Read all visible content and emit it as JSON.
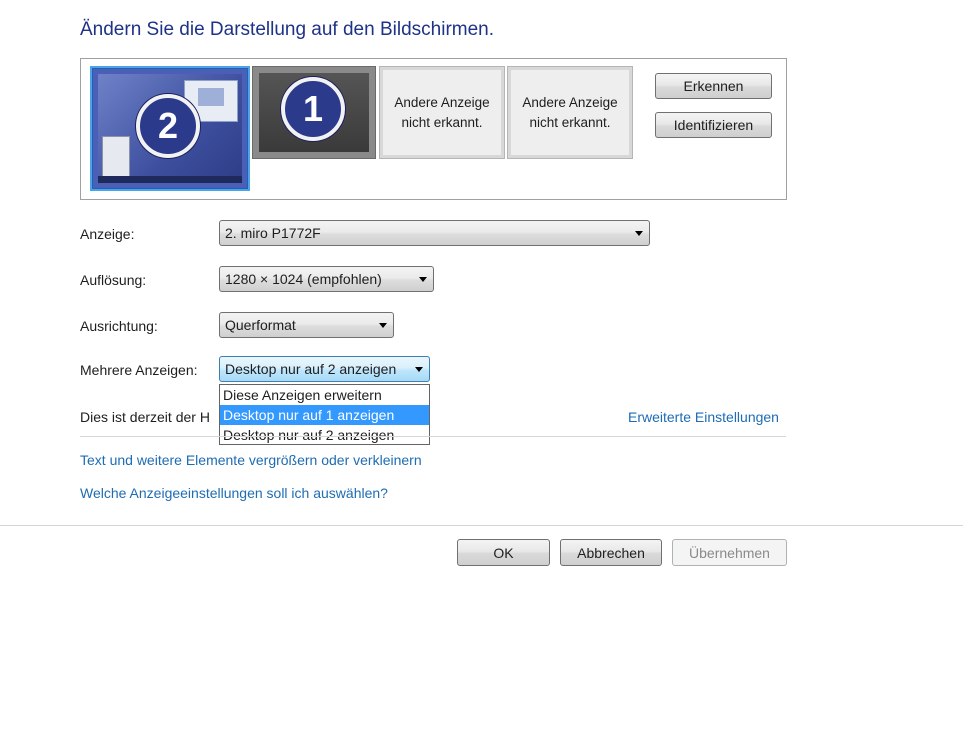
{
  "title": "Ändern Sie die Darstellung auf den Bildschirmen.",
  "monitors": {
    "selected_number": "2",
    "second_number": "1",
    "not_detected_1": "Andere Anzeige nicht erkannt.",
    "not_detected_2": "Andere Anzeige nicht erkannt."
  },
  "buttons": {
    "detect": "Erkennen",
    "identify": "Identifizieren",
    "ok": "OK",
    "cancel": "Abbrechen",
    "apply": "Übernehmen"
  },
  "fields": {
    "display_label": "Anzeige:",
    "display_value": "2. miro P1772F",
    "resolution_label": "Auflösung:",
    "resolution_value": "1280 × 1024 (empfohlen)",
    "orientation_label": "Ausrichtung:",
    "orientation_value": "Querformat",
    "multiple_label": "Mehrere Anzeigen:",
    "multiple_value": "Desktop nur auf 2 anzeigen"
  },
  "dropdown_options": [
    "Diese Anzeigen erweitern",
    "Desktop nur auf 1 anzeigen",
    "Desktop nur auf 2 anzeigen"
  ],
  "status_text": "Dies ist derzeit der H",
  "links": {
    "advanced": "Erweiterte Einstellungen",
    "text_size": "Text und weitere Elemente vergrößern oder verkleinern",
    "which_settings": "Welche Anzeigeeinstellungen soll ich auswählen?"
  }
}
